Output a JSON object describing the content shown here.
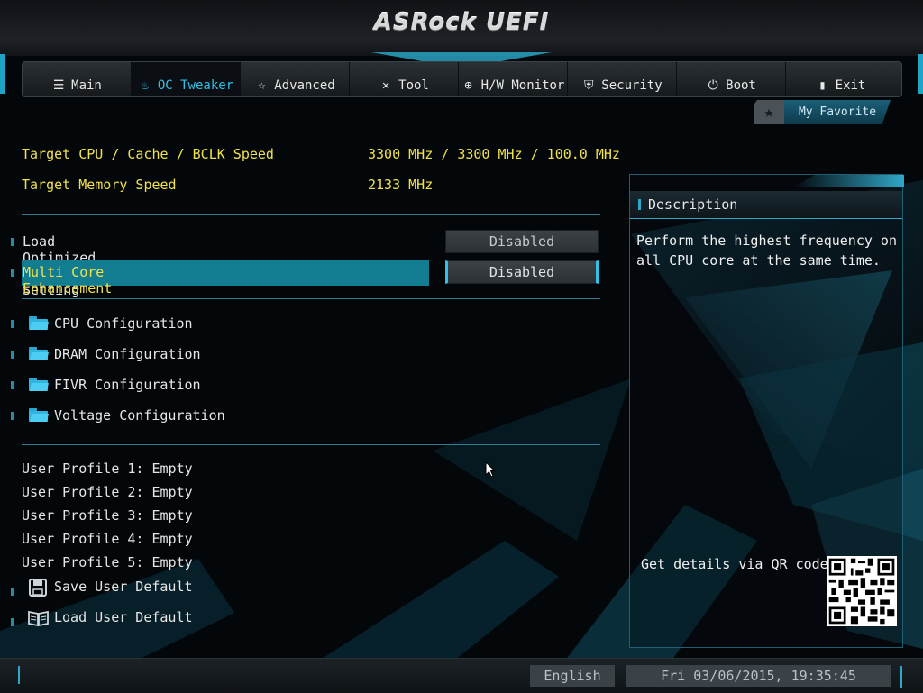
{
  "brand": {
    "logo": "ASRock UEFI"
  },
  "nav": {
    "tabs": [
      {
        "label": "Main",
        "icon": "list-icon"
      },
      {
        "label": "OC Tweaker",
        "icon": "flame-icon",
        "active": true
      },
      {
        "label": "Advanced",
        "icon": "star-wand-icon"
      },
      {
        "label": "Tool",
        "icon": "tools-icon"
      },
      {
        "label": "H/W Monitor",
        "icon": "crosshair-icon"
      },
      {
        "label": "Security",
        "icon": "shield-icon"
      },
      {
        "label": "Boot",
        "icon": "power-icon"
      },
      {
        "label": "Exit",
        "icon": "door-icon"
      }
    ],
    "favorite_label": "My Favorite"
  },
  "info": {
    "target_cpu_label": "Target CPU / Cache / BCLK Speed",
    "target_cpu_value": "3300 MHz / 3300 MHz / 100.0 MHz",
    "target_mem_label": "Target Memory Speed",
    "target_mem_value": "2133 MHz"
  },
  "settings": {
    "load_opt_label": "Load Optimized CPU OC Setting",
    "load_opt_value": "Disabled",
    "mce_label": "Multi Core Enhancement",
    "mce_value": "Disabled"
  },
  "submenus": [
    "CPU Configuration",
    "DRAM Configuration",
    "FIVR Configuration",
    "Voltage Configuration"
  ],
  "profiles": [
    "User Profile 1: Empty",
    "User Profile 2: Empty",
    "User Profile 3: Empty",
    "User Profile 4: Empty",
    "User Profile 5: Empty"
  ],
  "actions": {
    "save_default": "Save User Default",
    "load_default": "Load User Default"
  },
  "description": {
    "title": "Description",
    "line1": "Perform the highest frequency on",
    "line2": "all CPU core at the same time.",
    "qr_label": "Get details via QR code"
  },
  "status": {
    "language": "English",
    "datetime": "Fri 03/06/2015, 19:35:45"
  },
  "colors": {
    "accent": "#2fc2e6",
    "highlight": "#127c91",
    "info_text": "#f2e24a"
  }
}
